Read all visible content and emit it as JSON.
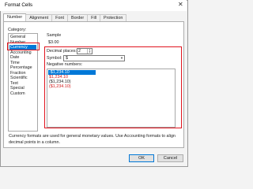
{
  "window": {
    "title": "Format Cells",
    "close_icon": "✕"
  },
  "tabs": [
    "Number",
    "Alignment",
    "Font",
    "Border",
    "Fill",
    "Protection"
  ],
  "category": {
    "label": "Category:",
    "items": [
      "General",
      "Number",
      "Currency",
      "Accounting",
      "Date",
      "Time",
      "Percentage",
      "Fraction",
      "Scientific",
      "Text",
      "Special",
      "Custom"
    ],
    "selected": "Currency"
  },
  "sample": {
    "label": "Sample",
    "value": "$3.00"
  },
  "decimal_places": {
    "label": "Decimal places:",
    "value": "2"
  },
  "symbol": {
    "label": "Symbol:",
    "value": "$"
  },
  "negative_numbers": {
    "label": "Negative numbers:",
    "items": [
      "-$1,234.10",
      "$1,234.10",
      "($1,234.10)",
      "($1,234.10)"
    ],
    "red": [
      false,
      true,
      false,
      true
    ],
    "selected_index": 0
  },
  "description": "Currency formats are used for general monetary values.  Use Accounting formats to align decimal points in a column.",
  "buttons": {
    "ok": "OK",
    "cancel": "Cancel"
  },
  "colors": {
    "highlight": "#e0141e",
    "selection": "#0078d7",
    "negative_red": "#d01919"
  }
}
